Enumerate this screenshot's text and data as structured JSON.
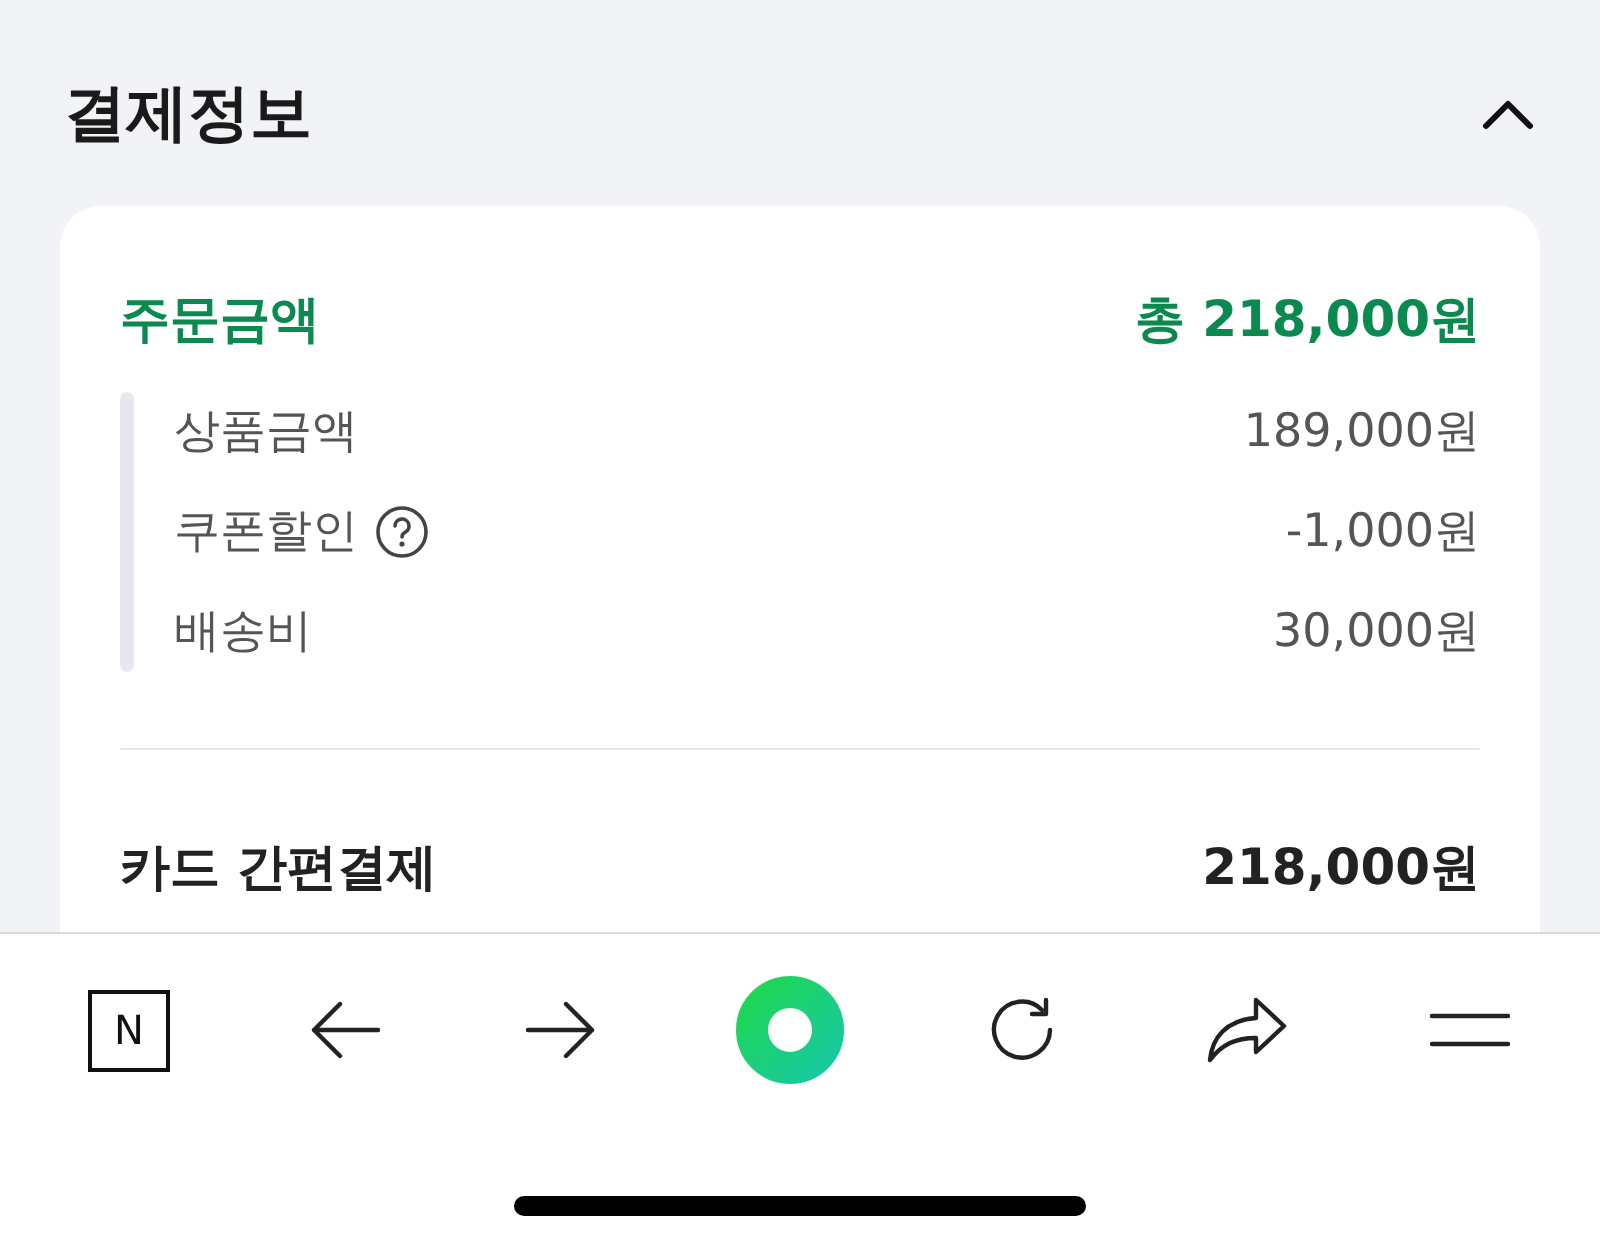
{
  "section": {
    "title": "결제정보",
    "expanded": true
  },
  "order_total": {
    "label": "주문금액",
    "value": "총 218,000원"
  },
  "breakdown": [
    {
      "label": "상품금액",
      "value": "189,000원",
      "help": false
    },
    {
      "label": "쿠폰할인",
      "value": "-1,000원",
      "help": true
    },
    {
      "label": "배송비",
      "value": "30,000원",
      "help": false
    }
  ],
  "payment": {
    "label": "카드 간편결제",
    "value": "218,000원"
  },
  "toolbar": {
    "logo_text": "N",
    "buttons": [
      {
        "kind": "back"
      },
      {
        "kind": "forward"
      },
      {
        "kind": "home"
      },
      {
        "kind": "reload"
      },
      {
        "kind": "share"
      },
      {
        "kind": "menu"
      }
    ]
  }
}
